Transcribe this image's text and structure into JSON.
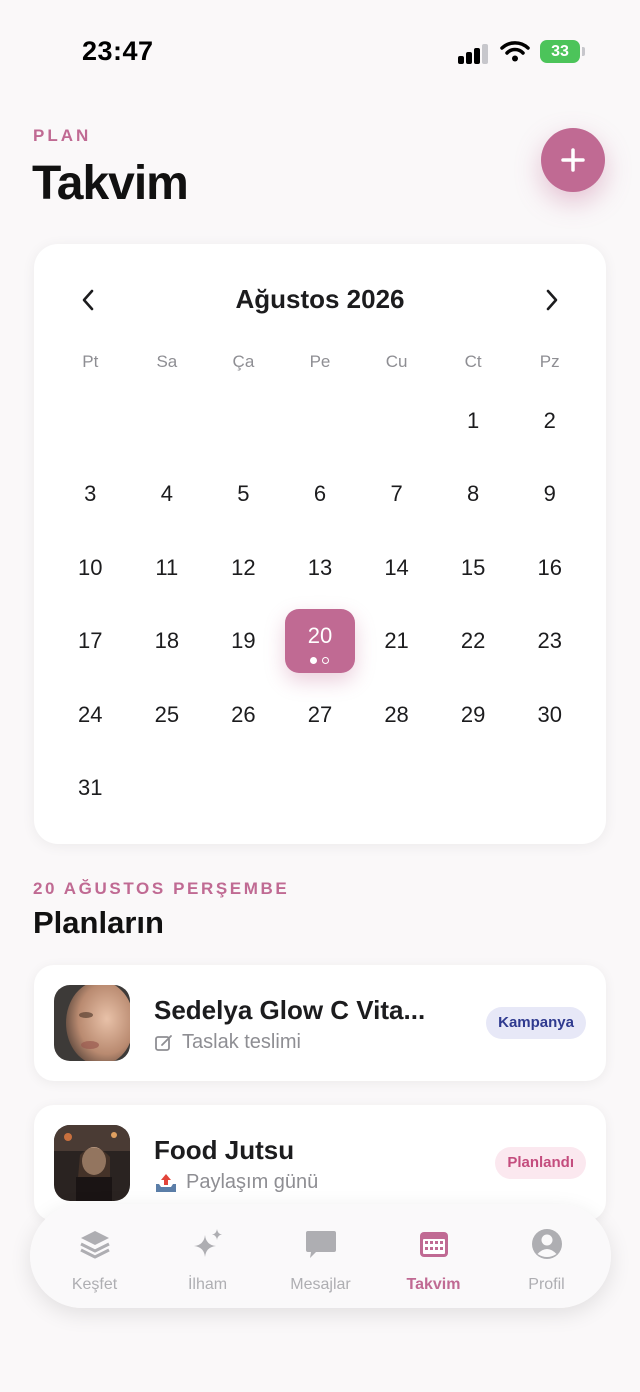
{
  "status_bar": {
    "time": "23:47",
    "battery": "33"
  },
  "header": {
    "eyebrow": "PLAN",
    "title": "Takvim",
    "add_icon": "plus-icon"
  },
  "calendar": {
    "month_label": "Ağustos 2026",
    "weekdays": [
      "Pt",
      "Sa",
      "Ça",
      "Pe",
      "Cu",
      "Ct",
      "Pz"
    ],
    "leading_blanks": 5,
    "days_in_month": 31,
    "selected_day": 20,
    "selected_day_dots": [
      "filled",
      "outline"
    ]
  },
  "plans_section": {
    "date_label": "20 AĞUSTOS PERŞEMBE",
    "title": "Planların",
    "items": [
      {
        "title": "Sedelya Glow C Vita...",
        "subtitle": "Taslak teslimi",
        "subtitle_icon": "edit-icon",
        "badge": "Kampanya",
        "badge_color": "#2f3a8f"
      },
      {
        "title": "Food Jutsu",
        "subtitle": "Paylaşım günü",
        "subtitle_icon": "outbox-tray-icon",
        "badge": "Planlandı",
        "badge_color": "#c44d7e"
      }
    ]
  },
  "tab_bar": {
    "tabs": [
      {
        "label": "Keşfet",
        "icon": "layers-icon"
      },
      {
        "label": "İlham",
        "icon": "sparkles-icon"
      },
      {
        "label": "Mesajlar",
        "icon": "chat-bubble-icon"
      },
      {
        "label": "Takvim",
        "icon": "calendar-icon",
        "active": true
      },
      {
        "label": "Profil",
        "icon": "person-icon"
      }
    ]
  },
  "colors": {
    "accent": "#c06a93",
    "background": "#faf8f9",
    "card": "#ffffff"
  }
}
